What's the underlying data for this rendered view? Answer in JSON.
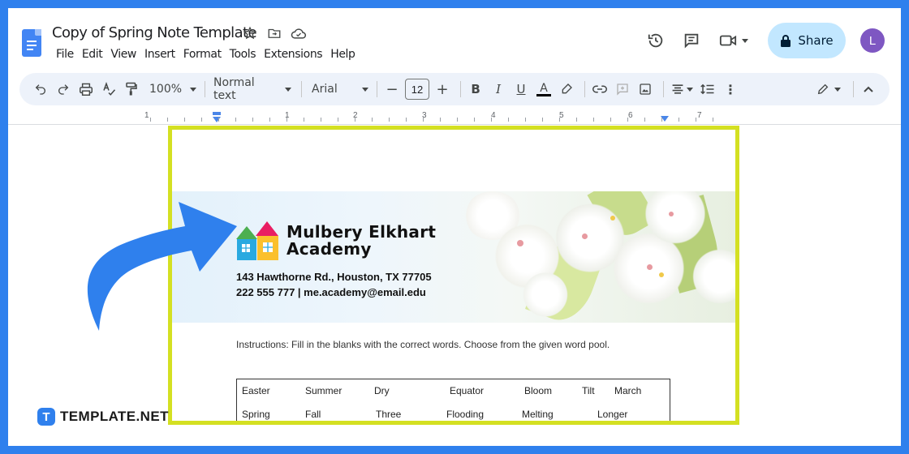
{
  "doc": {
    "title": "Copy of Spring Note Template",
    "menu": [
      "File",
      "Edit",
      "View",
      "Insert",
      "Format",
      "Tools",
      "Extensions",
      "Help"
    ],
    "share_label": "Share",
    "avatar_initial": "L"
  },
  "toolbar": {
    "zoom": "100%",
    "style": "Normal text",
    "font": "Arial",
    "font_size": "12"
  },
  "ruler": {
    "numbers": [
      "1",
      "1",
      "2",
      "3",
      "4",
      "5",
      "6",
      "7"
    ]
  },
  "page": {
    "school_name_line1": "Mulbery Elkhart",
    "school_name_line2": "Academy",
    "address": "143 Hawthorne Rd., Houston, TX 77705",
    "contact": "222 555 777 | me.academy@email.edu",
    "instructions": "Instructions: Fill in the blanks with the correct words. Choose from the given word pool.",
    "word_pool_row1": [
      "Easter",
      "Summer",
      "Dry",
      "Equator",
      "Bloom",
      "Tilt",
      "March"
    ],
    "word_pool_row2": [
      "Spring",
      "Fall",
      "Three",
      "Flooding",
      "Melting",
      "Longer"
    ]
  },
  "branding": {
    "logo_letter": "T",
    "name": "TEMPLATE.NET"
  },
  "colors": {
    "background": "#2f80ed",
    "highlight_border": "#d4e022",
    "share_bg": "#c2e7ff",
    "avatar": "#7e57c2",
    "arrow": "#2f80ed"
  }
}
